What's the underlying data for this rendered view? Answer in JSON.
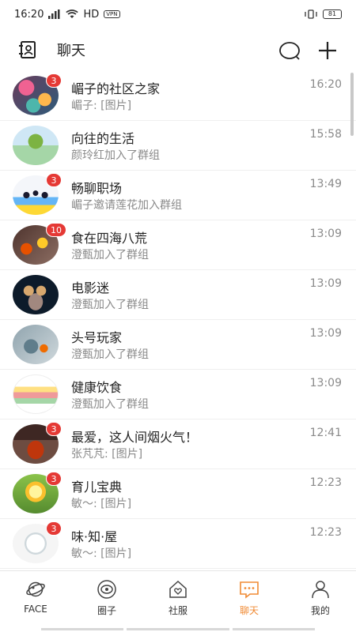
{
  "status": {
    "time": "16:20",
    "network": "HD",
    "vpn": "VPN",
    "battery": "81"
  },
  "header": {
    "title": "聊天"
  },
  "chats": [
    {
      "name": "嵋子的社区之家",
      "message": "嵋子: [图片]",
      "time": "16:20",
      "badge": "3"
    },
    {
      "name": "向往的生活",
      "message": "颜玲红加入了群组",
      "time": "15:58",
      "badge": ""
    },
    {
      "name": "畅聊职场",
      "message": "嵋子邀请莲花加入群组",
      "time": "13:49",
      "badge": "3"
    },
    {
      "name": "食在四海八荒",
      "message": "澄甄加入了群组",
      "time": "13:09",
      "badge": "10"
    },
    {
      "name": "电影迷",
      "message": "澄甄加入了群组",
      "time": "13:09",
      "badge": ""
    },
    {
      "name": "头号玩家",
      "message": "澄甄加入了群组",
      "time": "13:09",
      "badge": ""
    },
    {
      "name": "健康饮食",
      "message": "澄甄加入了群组",
      "time": "13:09",
      "badge": ""
    },
    {
      "name": "最爱，这人间烟火气！",
      "message": "张芃芃: [图片]",
      "time": "12:41",
      "badge": "3"
    },
    {
      "name": "育儿宝典",
      "message": "敏〜: [图片]",
      "time": "12:23",
      "badge": "3"
    },
    {
      "name": "味·知·屋",
      "message": "敏〜: [图片]",
      "time": "12:23",
      "badge": "3"
    }
  ],
  "tabs": [
    {
      "label": "FACE",
      "icon": "planet-icon"
    },
    {
      "label": "圈子",
      "icon": "circle-icon"
    },
    {
      "label": "社服",
      "icon": "house-heart-icon"
    },
    {
      "label": "聊天",
      "icon": "chat-bubble-icon"
    },
    {
      "label": "我的",
      "icon": "person-icon"
    }
  ],
  "colors": {
    "accent": "#f08a33",
    "badge": "#e53935",
    "text": "#222222",
    "subtext": "#8a8a8a"
  }
}
